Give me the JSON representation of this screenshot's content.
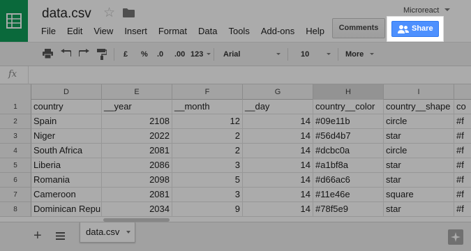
{
  "header": {
    "doc_title": "data.csv",
    "account": "Microreact",
    "menu": [
      "File",
      "Edit",
      "View",
      "Insert",
      "Format",
      "Data",
      "Tools",
      "Add-ons",
      "Help"
    ],
    "comments_label": "Comments",
    "share_label": "Share"
  },
  "toolbar": {
    "currency": "£",
    "percent": "%",
    "dec_decrease": ".0",
    "dec_increase": ".00",
    "more_formats": "123",
    "font": "Arial",
    "font_size": "10",
    "more": "More"
  },
  "grid": {
    "columns": [
      "D",
      "E",
      "F",
      "G",
      "H",
      "I"
    ],
    "selected_column": "H",
    "rows": [
      {
        "num": "1",
        "cells": [
          "country",
          "__year",
          "__month",
          "__day",
          "country__color",
          "country__shape",
          "co"
        ]
      },
      {
        "num": "2",
        "cells": [
          "Spain",
          "2108",
          "12",
          "14",
          "#09e11b",
          "circle",
          "#f"
        ]
      },
      {
        "num": "3",
        "cells": [
          "Niger",
          "2022",
          "2",
          "14",
          "#56d4b7",
          "star",
          "#f"
        ]
      },
      {
        "num": "4",
        "cells": [
          "South Africa",
          "2081",
          "2",
          "14",
          "#dcbc0a",
          "circle",
          "#f"
        ]
      },
      {
        "num": "5",
        "cells": [
          "Liberia",
          "2086",
          "3",
          "14",
          "#a1bf8a",
          "star",
          "#f"
        ]
      },
      {
        "num": "6",
        "cells": [
          "Romania",
          "2098",
          "5",
          "14",
          "#d66ac6",
          "star",
          "#f"
        ]
      },
      {
        "num": "7",
        "cells": [
          "Cameroon",
          "2081",
          "3",
          "14",
          "#11e46e",
          "square",
          "#f"
        ]
      },
      {
        "num": "8",
        "cells": [
          "Dominican Repu",
          "2034",
          "9",
          "14",
          "#78f5e9",
          "star",
          "#f"
        ]
      }
    ]
  },
  "bottom": {
    "sheet_tab": "data.csv"
  },
  "colors": {
    "brand_green": "#0f9d58",
    "share_blue": "#4d90fe"
  }
}
